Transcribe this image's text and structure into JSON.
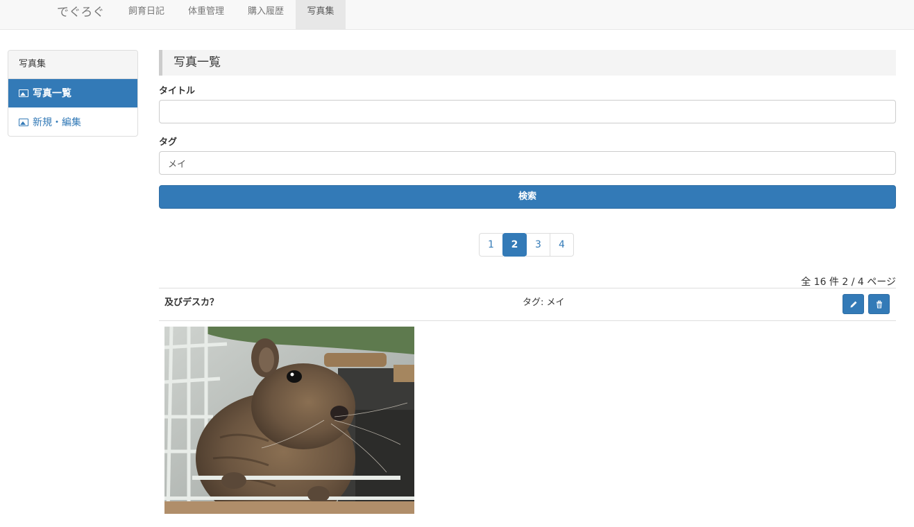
{
  "navbar": {
    "brand": "でぐろぐ",
    "items": [
      {
        "label": "飼育日記",
        "active": false
      },
      {
        "label": "体重管理",
        "active": false
      },
      {
        "label": "購入履歴",
        "active": false
      },
      {
        "label": "写真集",
        "active": true
      }
    ]
  },
  "sidebar": {
    "heading": "写真集",
    "items": [
      {
        "label": "写真一覧",
        "icon": "picture-icon",
        "active": true
      },
      {
        "label": "新規・編集",
        "icon": "picture-icon",
        "active": false
      }
    ]
  },
  "main": {
    "header": "写真一覧",
    "title_label": "タイトル",
    "title_value": "",
    "tag_label": "タグ",
    "tag_value": "メイ",
    "search_button": "検索",
    "pagination": [
      {
        "label": "1",
        "active": false
      },
      {
        "label": "2",
        "active": true
      },
      {
        "label": "3",
        "active": false
      },
      {
        "label": "4",
        "active": false
      }
    ],
    "count_text": "全 16 件 2 / 4 ページ",
    "photo": {
      "title": "及びデスカ？",
      "tag_text": "タグ: メイ",
      "edit_icon": "pencil-icon",
      "delete_icon": "trash-icon"
    }
  },
  "colors": {
    "primary": "#337ab7",
    "navbar_bg": "#f8f8f8",
    "header_bg": "#f4f4f4"
  }
}
